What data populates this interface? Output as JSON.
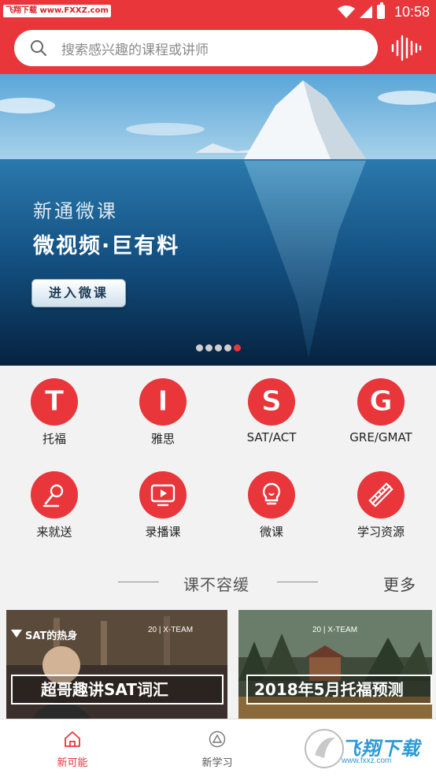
{
  "status_bar": {
    "badge": "飞翔下载 www.FXXZ.com",
    "time": "10:58"
  },
  "search": {
    "placeholder": "搜索感兴趣的课程或讲师"
  },
  "banner": {
    "subtitle": "新通微课",
    "title": "微视频·巨有料",
    "button": "进入微课",
    "dots_total": 5,
    "dots_active_index": 4
  },
  "categories": [
    {
      "letter": "T",
      "label": "托福"
    },
    {
      "letter": "I",
      "label": "雅思"
    },
    {
      "letter": "S",
      "label": "SAT/ACT"
    },
    {
      "letter": "G",
      "label": "GRE/GMAT"
    },
    {
      "icon": "microphone-icon",
      "label": "来就送"
    },
    {
      "icon": "video-play-icon",
      "label": "录播课"
    },
    {
      "icon": "lightbulb-icon",
      "label": "微课"
    },
    {
      "icon": "pencil-ruler-icon",
      "label": "学习资源"
    }
  ],
  "section": {
    "title": "课不容缓",
    "more": "更多"
  },
  "courses": [
    {
      "tag": "SAT的热身",
      "logo": "20 | X-TEAM",
      "title": "超哥趣讲SAT词汇"
    },
    {
      "tag": "",
      "logo": "20 | X-TEAM",
      "title": "2018年5月托福预测"
    }
  ],
  "bottom_nav": [
    {
      "label": "新可能",
      "icon": "home-icon",
      "active": true
    },
    {
      "label": "新学习",
      "icon": "triangle-icon",
      "active": false
    }
  ],
  "watermark": {
    "text": "飞翔下载",
    "url": "www.fxxz.com"
  },
  "colors": {
    "brand_red": "#e8363b",
    "active_nav": "#e8363b",
    "inactive_nav": "#555555"
  }
}
